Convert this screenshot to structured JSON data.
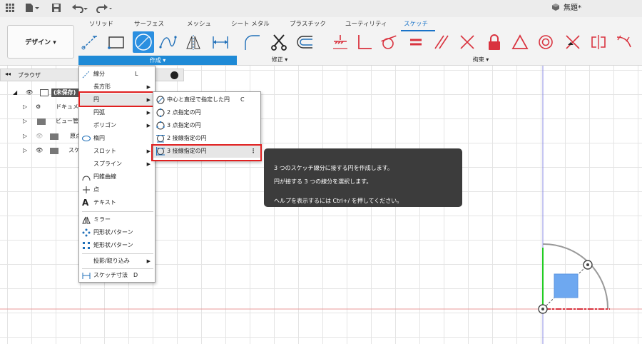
{
  "app": {
    "document_title": "無題*"
  },
  "tabs": [
    {
      "label": "ソリッド"
    },
    {
      "label": "サーフェス"
    },
    {
      "label": "メッシュ"
    },
    {
      "label": "シート メタル"
    },
    {
      "label": "プラスチック"
    },
    {
      "label": "ユーティリティ"
    },
    {
      "label": "スケッチ"
    }
  ],
  "workspace": {
    "label": "デザイン ▾"
  },
  "ribbon_groups": {
    "create": "作成 ▾",
    "modify": "修正 ▾",
    "constraints": "拘束 ▾"
  },
  "browser": {
    "title": "ブラウザ",
    "items": [
      {
        "label": "(未保存)"
      },
      {
        "label": "ドキュメント設定"
      },
      {
        "label": "ビュー管理"
      },
      {
        "label": "原点"
      },
      {
        "label": "スケッチ"
      }
    ]
  },
  "create_menu": {
    "items": [
      {
        "label": "線分",
        "shortcut": "L"
      },
      {
        "label": "長方形",
        "submenu": "▶"
      },
      {
        "label": "円",
        "submenu": "▶"
      },
      {
        "label": "円弧",
        "submenu": "▶"
      },
      {
        "label": "ポリゴン",
        "submenu": "▶"
      },
      {
        "label": "楕円"
      },
      {
        "label": "スロット",
        "submenu": "▶"
      },
      {
        "label": "スプライン",
        "submenu": "▶"
      },
      {
        "label": "円錐曲線"
      },
      {
        "label": "点"
      },
      {
        "label": "テキスト"
      },
      {
        "label": "ミラー"
      },
      {
        "label": "円形状パターン"
      },
      {
        "label": "矩形状パターン"
      },
      {
        "label": "投影/取り込み",
        "submenu": "▶"
      },
      {
        "label": "スケッチ寸法",
        "shortcut": "D"
      }
    ]
  },
  "circle_submenu": {
    "items": [
      {
        "label": "中心と直径で指定した円",
        "shortcut": "C"
      },
      {
        "label": "2 点指定の円"
      },
      {
        "label": "3 点指定の円"
      },
      {
        "label": "2 接線指定の円"
      },
      {
        "label": "3 接線指定の円",
        "more": "⋮"
      }
    ]
  },
  "tooltip": {
    "line1": "3 つのスケッチ線分に接する円を作成します。",
    "line2": "円が接する 3 つの線分を選択します。",
    "line3": "ヘルプを表示するには Ctrl+/ を押してください。"
  },
  "colors": {
    "accent": "#1f8ad6",
    "highlight_border": "#e02020",
    "tooltip_bg": "#3c3c3c",
    "constraint_red": "#d9333f",
    "sketch_blue": "#6ea8f0"
  }
}
